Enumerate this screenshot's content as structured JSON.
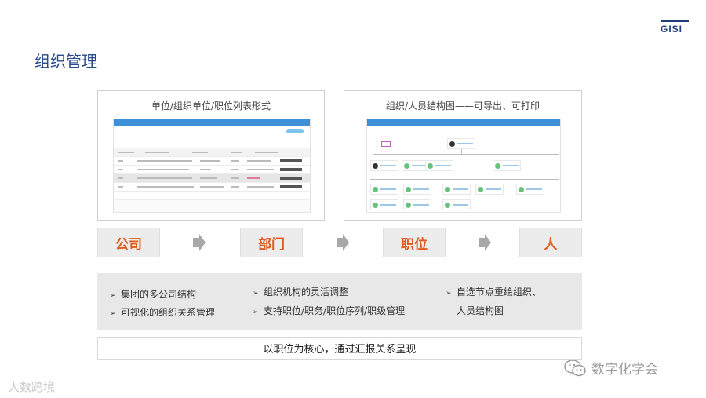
{
  "brand": {
    "logo_text": "GISI"
  },
  "slide": {
    "title": "组织管理"
  },
  "panels": {
    "left_caption": "单位/组织单位/职位列表形式",
    "right_caption": "组织/人员结构图——可导出、可打印"
  },
  "flow": {
    "steps": [
      "公司",
      "部门",
      "职位",
      "人"
    ]
  },
  "features": {
    "col1": [
      "集团的多公司结构",
      "可视化的组织关系管理"
    ],
    "col2": [
      "组织机构的灵活调整",
      "支持职位/职务/职位序列/职级管理"
    ],
    "col3": [
      "自选节点重绘组织、",
      "人员结构图"
    ],
    "bullet_marker": "➢"
  },
  "summary": "以职位为核心，通过汇报关系呈现",
  "watermarks": {
    "left": "大数跨境",
    "right": "数字化学会"
  },
  "colors": {
    "title": "#2a4a8a",
    "step_text": "#e05a1c",
    "app_header": "#3d8fd6"
  }
}
